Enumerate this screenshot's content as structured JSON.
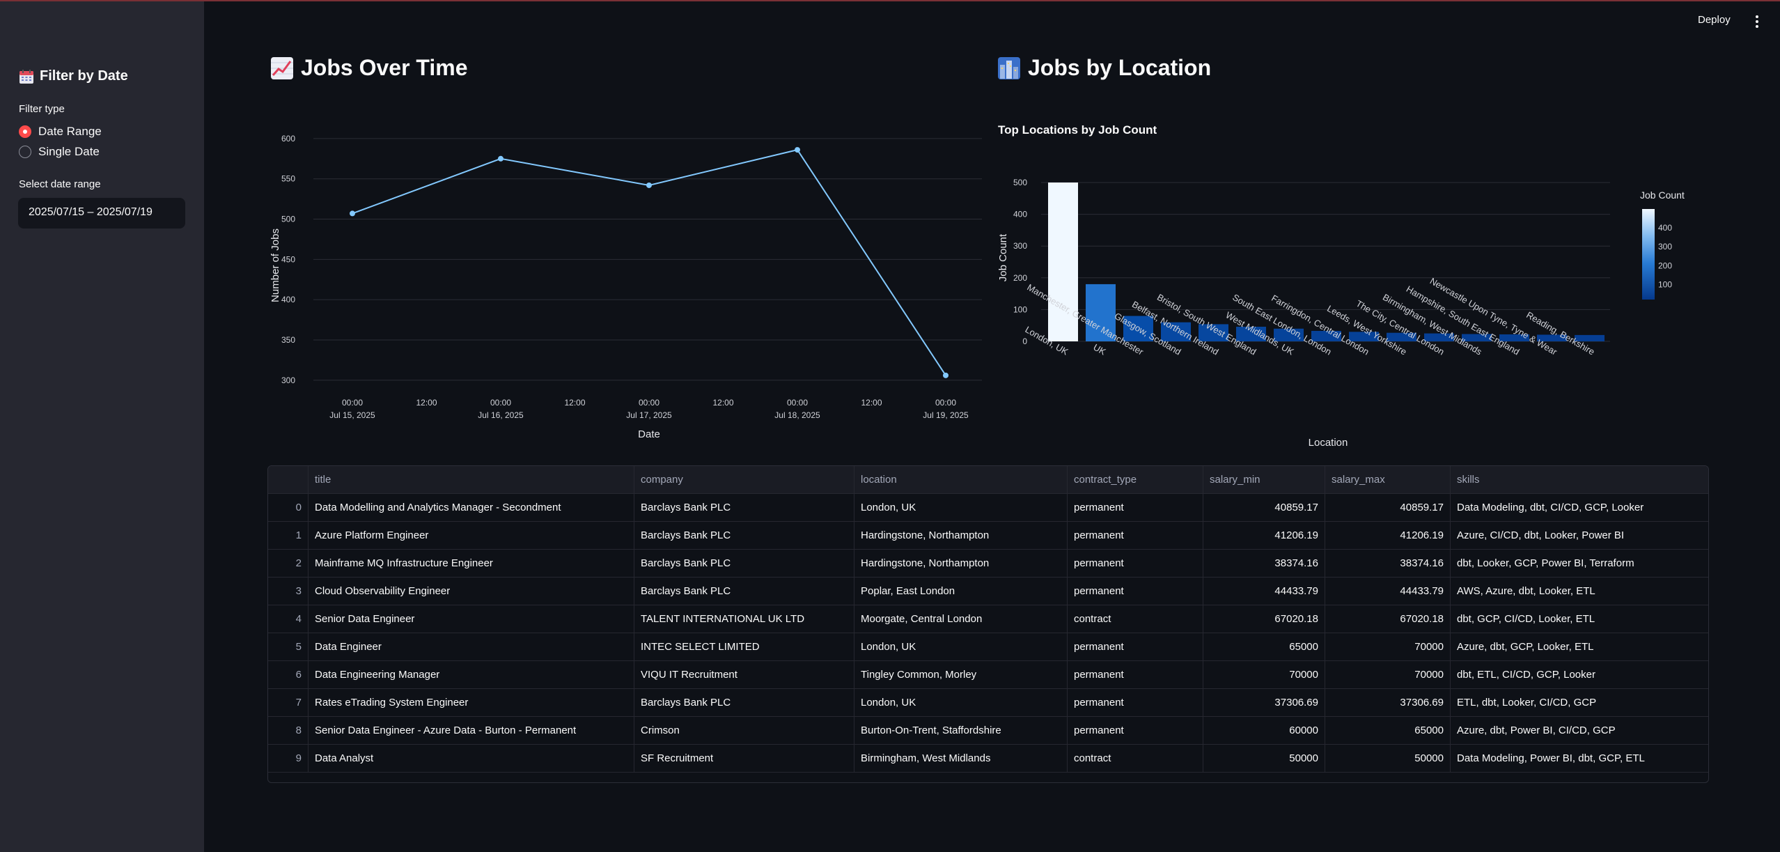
{
  "header": {
    "deploy_label": "Deploy",
    "menu_icon": "kebab-menu-icon"
  },
  "sidebar": {
    "title": "Filter by Date",
    "title_icon": "calendar-icon",
    "filter_type_label": "Filter type",
    "options": [
      {
        "label": "Date Range",
        "selected": true
      },
      {
        "label": "Single Date",
        "selected": false
      }
    ],
    "date_range_label": "Select date range",
    "date_range_value": "2025/07/15 – 2025/07/19"
  },
  "line_section": {
    "heading": "Jobs Over Time",
    "icon": "chart-increasing-icon"
  },
  "bar_section": {
    "heading": "Jobs by Location",
    "icon": "cityscape-icon"
  },
  "chart_data": [
    {
      "type": "line",
      "x": [
        "2025-07-15",
        "2025-07-16",
        "2025-07-17",
        "2025-07-18",
        "2025-07-19"
      ],
      "values": [
        507,
        575,
        542,
        586,
        306
      ],
      "xlabel": "Date",
      "ylabel": "Number of Jobs",
      "yticks": [
        300,
        350,
        400,
        450,
        500,
        550,
        600
      ],
      "ylim": [
        292,
        612
      ],
      "xticks": [
        {
          "l1": "00:00",
          "l2": "Jul 15, 2025"
        },
        {
          "l1": "12:00",
          "l2": ""
        },
        {
          "l1": "00:00",
          "l2": "Jul 16, 2025"
        },
        {
          "l1": "12:00",
          "l2": ""
        },
        {
          "l1": "00:00",
          "l2": "Jul 17, 2025"
        },
        {
          "l1": "12:00",
          "l2": ""
        },
        {
          "l1": "00:00",
          "l2": "Jul 18, 2025"
        },
        {
          "l1": "12:00",
          "l2": ""
        },
        {
          "l1": "00:00",
          "l2": "Jul 19, 2025"
        }
      ],
      "color": "#83c9ff",
      "grid": true
    },
    {
      "type": "bar",
      "title": "Top Locations by Job Count",
      "categories": [
        "London, UK",
        "UK",
        "Manchester, Greater Manchester",
        "Glasgow, Scotland",
        "Belfast, Northern Ireland",
        "Bristol, South West England",
        "West Midlands, UK",
        "South East London, London",
        "Farringdon, Central London",
        "Leeds, West Yorkshire",
        "The City, Central London",
        "Birmingham, West Midlands",
        "Hampshire, South East England",
        "Newcastle Upon Tyne, Tyne & Wear",
        "Reading, Berkshire"
      ],
      "values": [
        500,
        180,
        80,
        60,
        54,
        46,
        40,
        33,
        30,
        27,
        25,
        23,
        22,
        21,
        20
      ],
      "xlabel": "Location",
      "ylabel": "Job Count",
      "yticks": [
        0,
        100,
        200,
        300,
        400,
        500
      ],
      "ylim": [
        0,
        500
      ],
      "colorbar": {
        "title": "Job Count",
        "ticks": [
          100,
          200,
          300,
          400
        ]
      },
      "grid": true
    }
  ],
  "table": {
    "columns": [
      "",
      "title",
      "company",
      "location",
      "contract_type",
      "salary_min",
      "salary_max",
      "skills"
    ],
    "rows": [
      [
        "0",
        "Data Modelling and Analytics Manager - Secondment",
        "Barclays Bank PLC",
        "London, UK",
        "permanent",
        "40859.17",
        "40859.17",
        "Data Modeling, dbt, CI/CD, GCP, Looker"
      ],
      [
        "1",
        "Azure Platform Engineer",
        "Barclays Bank PLC",
        "Hardingstone, Northampton",
        "permanent",
        "41206.19",
        "41206.19",
        "Azure, CI/CD, dbt, Looker, Power BI"
      ],
      [
        "2",
        "Mainframe MQ Infrastructure Engineer",
        "Barclays Bank PLC",
        "Hardingstone, Northampton",
        "permanent",
        "38374.16",
        "38374.16",
        "dbt, Looker, GCP, Power BI, Terraform"
      ],
      [
        "3",
        "Cloud Observability Engineer",
        "Barclays Bank PLC",
        "Poplar, East London",
        "permanent",
        "44433.79",
        "44433.79",
        "AWS, Azure, dbt, Looker, ETL"
      ],
      [
        "4",
        "Senior Data Engineer",
        "TALENT INTERNATIONAL UK LTD",
        "Moorgate, Central London",
        "contract",
        "67020.18",
        "67020.18",
        "dbt, GCP, CI/CD, Looker, ETL"
      ],
      [
        "5",
        "Data Engineer",
        "INTEC SELECT LIMITED",
        "London, UK",
        "permanent",
        "65000",
        "70000",
        "Azure, dbt, GCP, Looker, ETL"
      ],
      [
        "6",
        "Data Engineering Manager",
        "VIQU IT Recruitment",
        "Tingley Common, Morley",
        "permanent",
        "70000",
        "70000",
        "dbt, ETL, CI/CD, GCP, Looker"
      ],
      [
        "7",
        "Rates eTrading System Engineer",
        "Barclays Bank PLC",
        "London, UK",
        "permanent",
        "37306.69",
        "37306.69",
        "ETL, dbt, Looker, CI/CD, GCP"
      ],
      [
        "8",
        "Senior Data Engineer - Azure Data - Burton - Permanent",
        "Crimson",
        "Burton-On-Trent, Staffordshire",
        "permanent",
        "60000",
        "65000",
        "Azure, dbt, Power BI, CI/CD, GCP"
      ],
      [
        "9",
        "Data Analyst",
        "SF Recruitment",
        "Birmingham, West Midlands",
        "contract",
        "50000",
        "50000",
        "Data Modeling, Power BI, dbt, GCP, ETL"
      ]
    ]
  }
}
